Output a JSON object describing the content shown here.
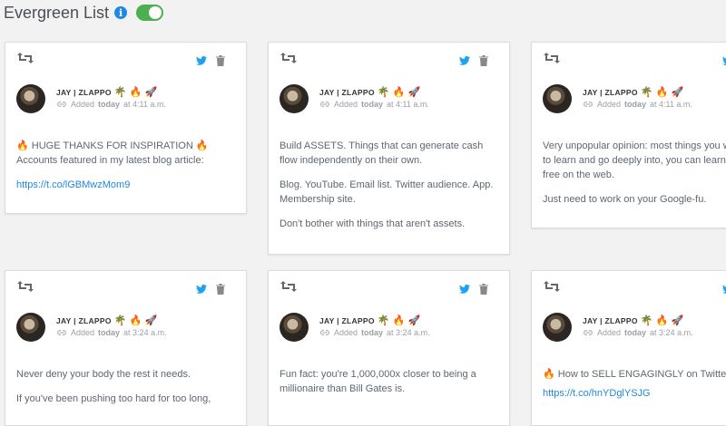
{
  "header": {
    "title": "Evergreen List"
  },
  "cards": [
    {
      "author": "JAY | ZLAPPO",
      "emojis": [
        "🌴",
        "🔥",
        "🚀"
      ],
      "added_prefix": "Added",
      "added_day": "today",
      "added_time": "at 4:11 a.m.",
      "lines": [
        "🔥 HUGE THANKS FOR INSPIRATION 🔥",
        "Accounts featured in my latest blog article:"
      ],
      "link": "https://t.co/lGBMwzMom9"
    },
    {
      "author": "JAY | ZLAPPO",
      "emojis": [
        "🌴",
        "🔥",
        "🚀"
      ],
      "added_prefix": "Added",
      "added_day": "today",
      "added_time": "at 4:11 a.m.",
      "paragraphs": [
        "Build ASSETS. Things that can generate cash flow independently on their own.",
        "Blog. YouTube. Email list. Twitter audience. App. Membership site.",
        "Don't bother with things that aren't assets."
      ]
    },
    {
      "author": "JAY | ZLAPPO",
      "emojis": [
        "🌴",
        "🔥",
        "🚀"
      ],
      "added_prefix": "Added",
      "added_day": "today",
      "added_time": "at 4:11 a.m.",
      "paragraphs": [
        "Very unpopular opinion: most things you want to learn and go deeply into, you can learn for free on the web.",
        "Just need to work on your Google-fu."
      ]
    },
    {
      "author": "JAY | ZLAPPO",
      "emojis": [
        "🌴",
        "🔥",
        "🚀"
      ],
      "added_prefix": "Added",
      "added_day": "today",
      "added_time": "at 3:24 a.m.",
      "paragraphs": [
        "Never deny your body the rest it needs.",
        "If you've been pushing too hard for too long,"
      ]
    },
    {
      "author": "JAY | ZLAPPO",
      "emojis": [
        "🌴",
        "🔥",
        "🚀"
      ],
      "added_prefix": "Added",
      "added_day": "today",
      "added_time": "at 3:24 a.m.",
      "paragraphs": [
        "Fun fact: you're 1,000,000x closer to being a millionaire than Bill Gates is."
      ]
    },
    {
      "author": "JAY | ZLAPPO",
      "emojis": [
        "🌴",
        "🔥",
        "🚀"
      ],
      "added_prefix": "Added",
      "added_day": "today",
      "added_time": "at 3:24 a.m.",
      "lines": [
        "🔥 How to SELL ENGAGINGLY on Twitter"
      ],
      "link": "https://t.co/hnYDglYSJG"
    }
  ]
}
